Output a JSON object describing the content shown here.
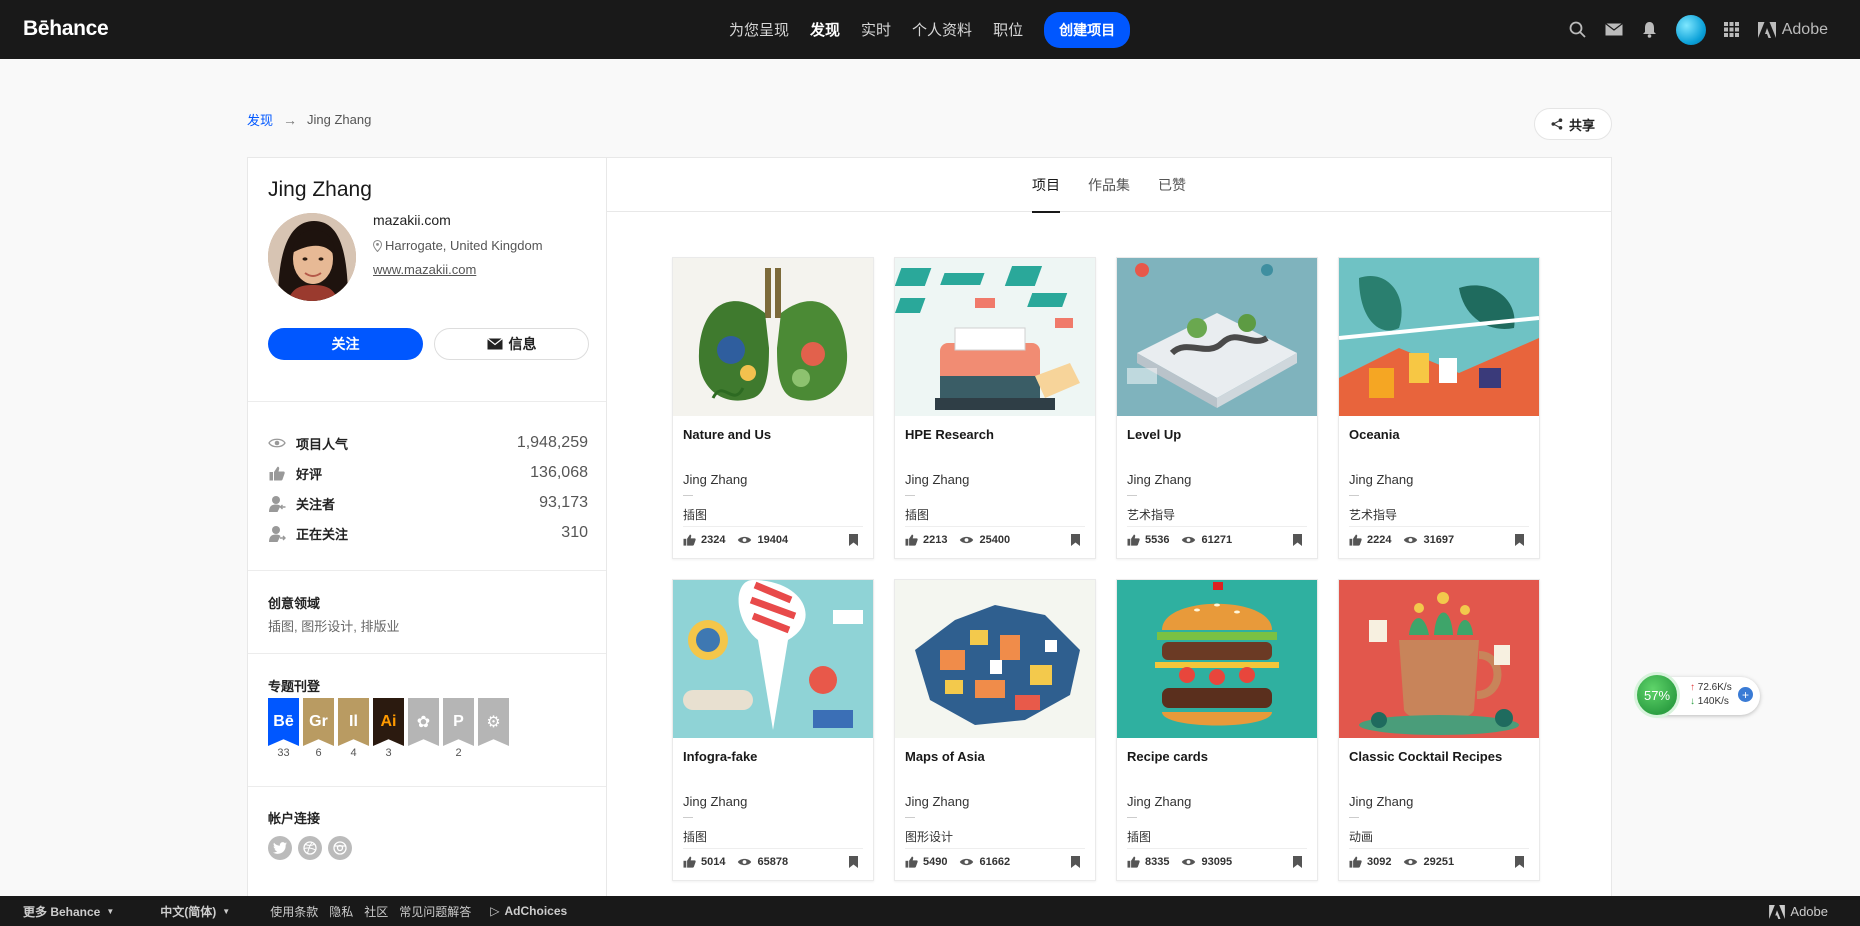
{
  "header": {
    "logo": "Bēhance",
    "nav": [
      "为您呈现",
      "发现",
      "实时",
      "个人资料",
      "职位"
    ],
    "create_label": "创建项目",
    "adobe_label": "Adobe"
  },
  "breadcrumb": {
    "link": "发现",
    "arrow": "→",
    "current": "Jing Zhang"
  },
  "share_label": "共享",
  "profile": {
    "name": "Jing Zhang",
    "site": "mazakii.com",
    "location": "Harrogate, United Kingdom",
    "link": "www.mazakii.com",
    "follow_label": "关注",
    "message_label": "信息"
  },
  "stats": [
    {
      "icon": "eye-icon",
      "label": "项目人气",
      "value": "1,948,259"
    },
    {
      "icon": "thumbs-up-icon",
      "label": "好评",
      "value": "136,068"
    },
    {
      "icon": "followers-icon",
      "label": "关注者",
      "value": "93,173"
    },
    {
      "icon": "following-icon",
      "label": "正在关注",
      "value": "310"
    }
  ],
  "creative_fields": {
    "title": "创意领域",
    "value": "插图, 图形设计, 排版业"
  },
  "featured": {
    "title": "专题刊登",
    "badges": [
      {
        "label": "Bē",
        "color": "#0057ff",
        "count": "33"
      },
      {
        "label": "Gr",
        "color": "#b99b62",
        "count": "6"
      },
      {
        "label": "Il",
        "color": "#b99b62",
        "count": "4"
      },
      {
        "label": "Ai",
        "color": "#2b1a0f",
        "count": "3"
      },
      {
        "label": "✿",
        "color": "#b5b5b5",
        "count": ""
      },
      {
        "label": "P",
        "color": "#b5b5b5",
        "count": "2"
      },
      {
        "label": "⚙",
        "color": "#b5b5b5",
        "count": ""
      }
    ]
  },
  "accounts": {
    "title": "帐户连接"
  },
  "tabs": [
    "项目",
    "作品集",
    "已赞"
  ],
  "projects": [
    {
      "title": "Nature and Us",
      "owner": "Jing Zhang",
      "field": "插图",
      "likes": "2324",
      "views": "19404"
    },
    {
      "title": "HPE Research",
      "owner": "Jing Zhang",
      "field": "插图",
      "likes": "2213",
      "views": "25400"
    },
    {
      "title": "Level Up",
      "owner": "Jing Zhang",
      "field": "艺术指导",
      "likes": "5536",
      "views": "61271"
    },
    {
      "title": "Oceania",
      "owner": "Jing Zhang",
      "field": "艺术指导",
      "likes": "2224",
      "views": "31697"
    },
    {
      "title": "Infogra-fake",
      "owner": "Jing Zhang",
      "field": "插图",
      "likes": "5014",
      "views": "65878"
    },
    {
      "title": "Maps of Asia",
      "owner": "Jing Zhang",
      "field": "图形设计",
      "likes": "5490",
      "views": "61662"
    },
    {
      "title": "Recipe cards",
      "owner": "Jing Zhang",
      "field": "插图",
      "likes": "8335",
      "views": "93095"
    },
    {
      "title": "Classic Cocktail Recipes",
      "owner": "Jing Zhang",
      "field": "动画",
      "likes": "3092",
      "views": "29251"
    }
  ],
  "speed_widget": {
    "percent": "57%",
    "up": "72.6K/s",
    "down": "140K/s"
  },
  "footer": {
    "more": "更多 Behance",
    "language": "中文(简体)",
    "links": [
      "使用条款",
      "隐私",
      "社区",
      "常见问题解答"
    ],
    "adchoices": "AdChoices",
    "adobe": "Adobe"
  }
}
